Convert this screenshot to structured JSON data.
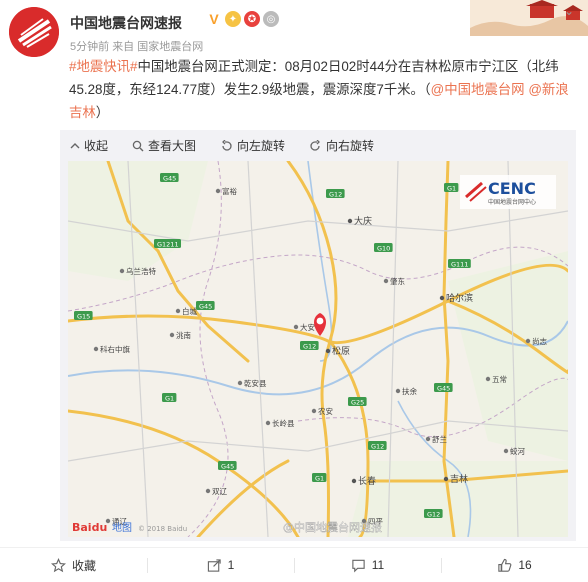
{
  "account": {
    "name": "中国地震台网速报",
    "badge_v": "V",
    "time": "5分钟前",
    "source_prefix": "来自",
    "source": "国家地震台网"
  },
  "post": {
    "hashtag": "#地震快讯#",
    "body": "中国地震台网正式测定：08月02日02时44分在吉林松原市宁江区（北纬45.28度，东经124.77度）发生2.9级地震，震源深度7千米。（",
    "mention1": "@中国地震台网",
    "mention2": "@新浪吉林",
    "tail": "）"
  },
  "toolbar": {
    "collapse": "收起",
    "view_large": "查看大图",
    "rotate_left": "向左旋转",
    "rotate_right": "向右旋转"
  },
  "map": {
    "logo_text": "CENC",
    "logo_sub": "中国地震台网中心",
    "baidu": "Baidu",
    "baidu_cn": "地图",
    "copyright": "© 2018 Baidu",
    "watermark": "@中国地震台网速报",
    "cities": [
      {
        "name": "大庆"
      },
      {
        "name": "哈尔滨"
      },
      {
        "name": "松原"
      },
      {
        "name": "长春"
      },
      {
        "name": "吉林"
      },
      {
        "name": "大安"
      },
      {
        "name": "乌兰浩特"
      },
      {
        "name": "白城"
      },
      {
        "name": "洮南"
      },
      {
        "name": "扶余"
      },
      {
        "name": "五常"
      },
      {
        "name": "肇东"
      },
      {
        "name": "四平"
      },
      {
        "name": "乾安县"
      },
      {
        "name": "长岭县"
      },
      {
        "name": "通辽"
      },
      {
        "name": "双辽"
      },
      {
        "name": "舒兰"
      },
      {
        "name": "尚志"
      },
      {
        "name": "农安"
      },
      {
        "name": "蛟河"
      },
      {
        "name": "科右中旗"
      },
      {
        "name": "富裕"
      }
    ],
    "roads": [
      "G45",
      "G12",
      "G1",
      "G10",
      "G1211",
      "G111",
      "G45",
      "G12",
      "G1",
      "G25",
      "G45",
      "G12",
      "G1",
      "G12",
      "G45",
      "G15"
    ]
  },
  "actions": {
    "favorite": "收藏",
    "share": "1",
    "comment": "11",
    "like": "16"
  }
}
